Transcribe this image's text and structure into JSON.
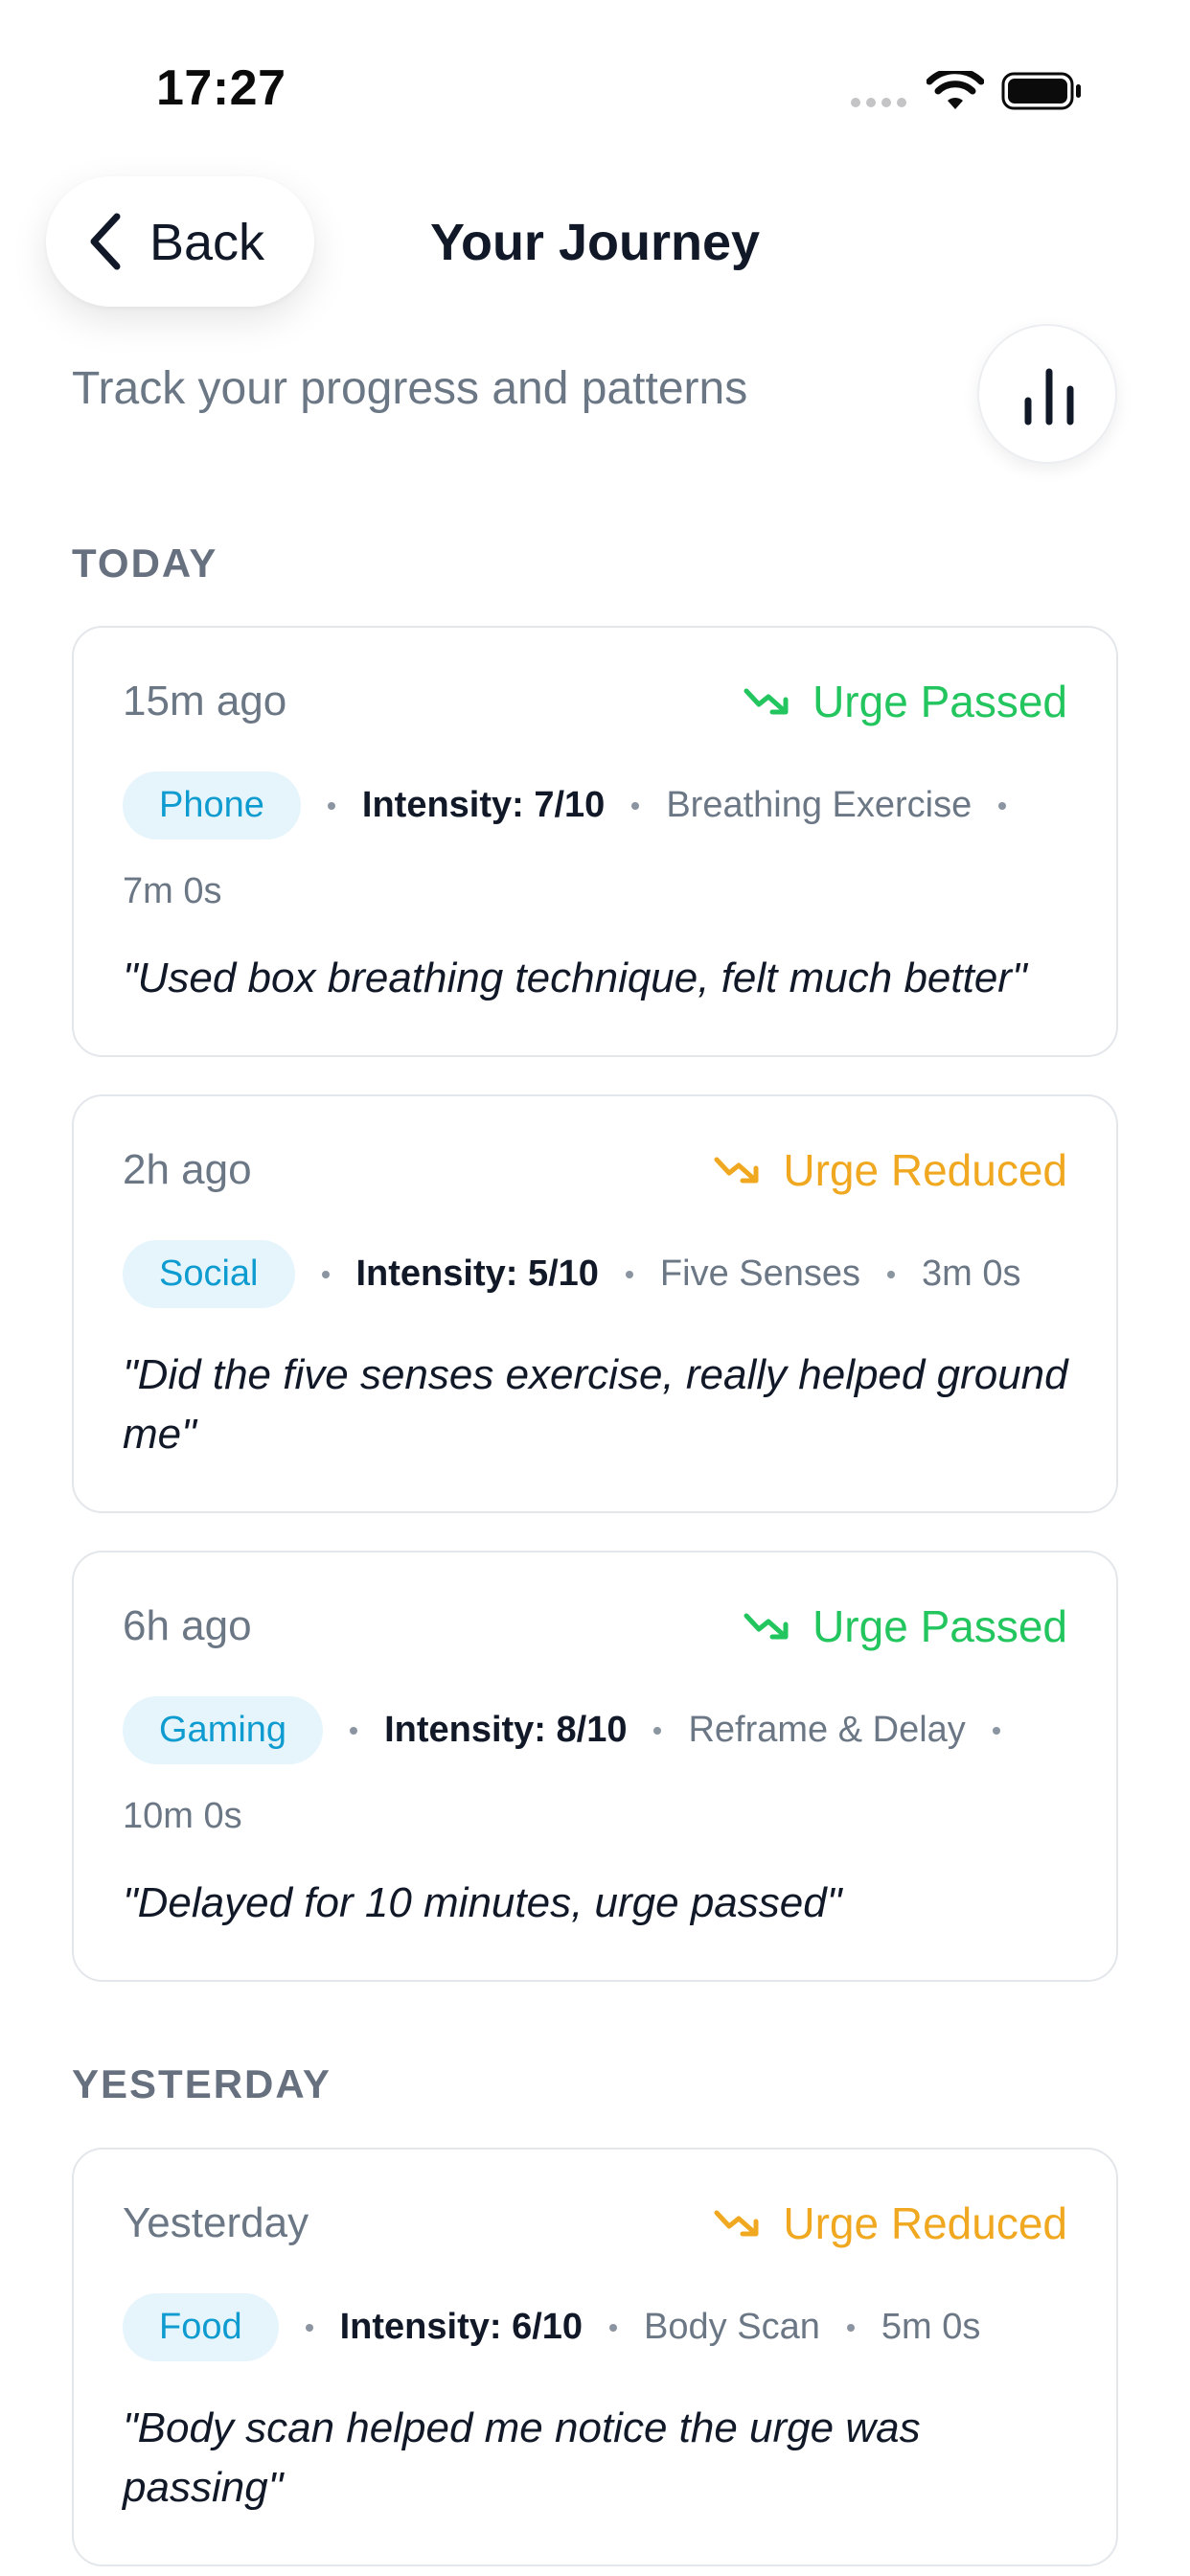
{
  "status_bar": {
    "time": "17:27"
  },
  "header": {
    "back_label": "Back",
    "title": "Your Journey"
  },
  "subtitle": "Track your progress and patterns",
  "colors": {
    "passed": "#22c55e",
    "reduced": "#f0a820",
    "chip_bg": "#e6f5fc",
    "chip_text": "#0e9bd0"
  },
  "sections": [
    {
      "label": "TODAY",
      "entries": [
        {
          "time": "15m ago",
          "status": "Urge Passed",
          "category": "Phone",
          "intensity": "Intensity: 7/10",
          "technique": "Breathing Exercise",
          "duration": "7m 0s",
          "note": "\"Used box breathing technique, felt much better\""
        },
        {
          "time": "2h ago",
          "status": "Urge Reduced",
          "category": "Social",
          "intensity": "Intensity: 5/10",
          "technique": "Five Senses",
          "duration": "3m 0s",
          "note": "\"Did the five senses exercise, really helped ground me\""
        },
        {
          "time": "6h ago",
          "status": "Urge Passed",
          "category": "Gaming",
          "intensity": "Intensity: 8/10",
          "technique": "Reframe & Delay",
          "duration": "10m 0s",
          "note": "\"Delayed for 10 minutes, urge passed\""
        }
      ]
    },
    {
      "label": "YESTERDAY",
      "entries": [
        {
          "time": "Yesterday",
          "status": "Urge Reduced",
          "category": "Food",
          "intensity": "Intensity: 6/10",
          "technique": "Body Scan",
          "duration": "5m 0s",
          "note": "\"Body scan helped me notice the urge was passing\""
        }
      ]
    }
  ]
}
